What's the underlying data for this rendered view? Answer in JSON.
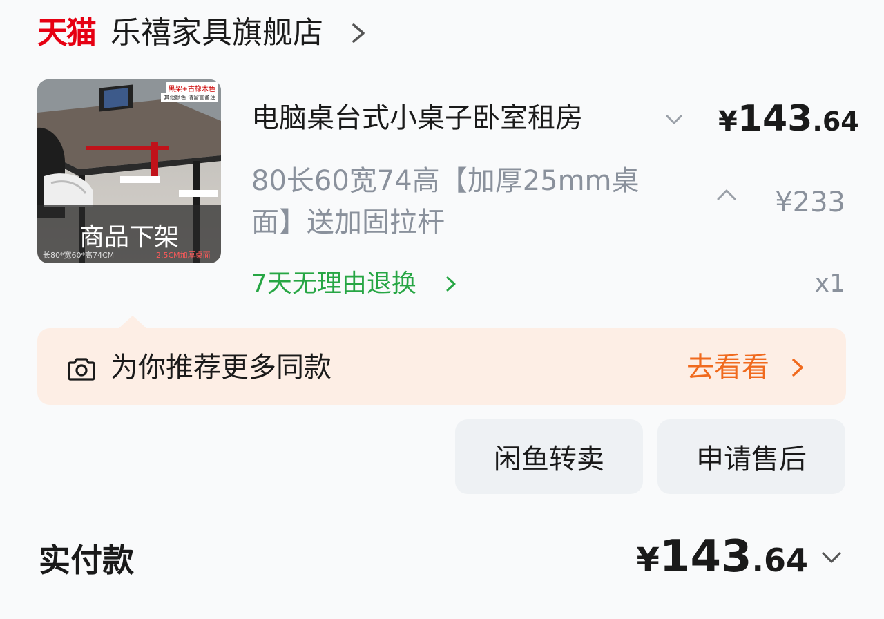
{
  "store": {
    "logo_text": "天猫",
    "name": "乐禧家具旗舰店"
  },
  "product": {
    "title": "电脑桌台式小桌子卧室租房",
    "price_current": {
      "symbol": "¥",
      "integer": "143",
      "decimal": ".64"
    },
    "spec": "80长60宽74高【加厚25mm桌面】送加固拉杆",
    "price_original": "¥233",
    "return_policy": "7天无理由退换",
    "quantity": "x1",
    "image": {
      "status_overlay": "商品下架",
      "tag_top": "黑架+古橡木色",
      "tag_top_sub": "其他颜色 请留言备注",
      "footer_left": "长80*宽60*高74CM",
      "footer_right": "2.5CM加厚桌面"
    }
  },
  "recommend": {
    "text": "为你推荐更多同款",
    "action": "去看看"
  },
  "actions": {
    "resell": "闲鱼转卖",
    "after_sale": "申请售后"
  },
  "total": {
    "label": "实付款",
    "price": {
      "symbol": "¥",
      "integer": "143",
      "decimal": ".64"
    }
  },
  "colors": {
    "brand_red": "#e60012",
    "green": "#27a644",
    "orange": "#f06a1e",
    "recommend_bg": "#fdeee5",
    "button_bg": "#eef1f4"
  },
  "icons": [
    "chevron-right-icon",
    "chevron-down-icon",
    "chevron-up-icon",
    "camera-icon"
  ]
}
